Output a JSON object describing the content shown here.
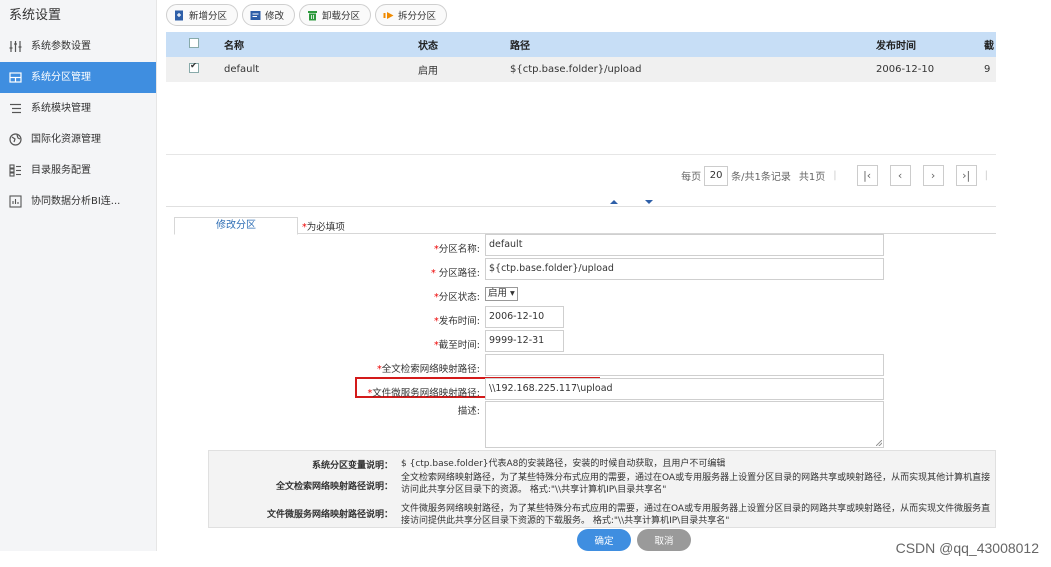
{
  "sidebar": {
    "title": "系统设置",
    "items": [
      {
        "label": "系统参数设置",
        "icon": "sliders-icon",
        "active": false
      },
      {
        "label": "系统分区管理",
        "icon": "partition-icon",
        "active": true
      },
      {
        "label": "系统模块管理",
        "icon": "list-icon",
        "active": false
      },
      {
        "label": "国际化资源管理",
        "icon": "globe-icon",
        "active": false
      },
      {
        "label": "目录服务配置",
        "icon": "directory-icon",
        "active": false
      },
      {
        "label": "协同数据分析BI连...",
        "icon": "bi-icon",
        "active": false
      }
    ]
  },
  "toolbar": {
    "add_label": "新增分区",
    "edit_label": "修改",
    "unload_label": "卸载分区",
    "split_label": "拆分分区"
  },
  "grid": {
    "columns": [
      "名称",
      "状态",
      "路径",
      "发布时间",
      "截"
    ],
    "rows": [
      {
        "checked": true,
        "name": "default",
        "status": "启用",
        "path": "${ctp.base.folder}/upload",
        "date": "2006-12-10",
        "more": "9"
      }
    ]
  },
  "pager": {
    "per_page_label": "每页",
    "page_size": "20",
    "records_text": "条/共1条记录",
    "total_pages": "共1页"
  },
  "form": {
    "tab_label": "修改分区",
    "required_note": "为必填项",
    "fields": {
      "name_label": "分区名称:",
      "name_value": "default",
      "path_label": "分区路径:",
      "path_value": "${ctp.base.folder}/upload",
      "status_label": "分区状态:",
      "status_value": "启用",
      "publish_label": "发布时间:",
      "publish_value": "2006-12-10",
      "expire_label": "截至时间:",
      "expire_value": "9999-12-31",
      "fulltext_label": "全文检索网络映射路径:",
      "fulltext_value": "",
      "fileservice_label": "文件微服务网络映射路径:",
      "fileservice_value": "\\\\192.168.225.117\\upload",
      "desc_label": "描述:"
    }
  },
  "info": {
    "var_label": "系统分区变量说明：",
    "var_text": "$ {ctp.base.folder}代表A8的安装路径，安装的时候自动获取，且用户不可编辑",
    "fulltext_label": "全文检索网络映射路径说明：",
    "fulltext_text": "全文检索网络映射路径，为了某些特殊分布式应用的需要，通过在OA或专用服务器上设置分区目录的网路共享或映射路径，从而实现其他计算机直接访问此共享分区目录下的资源。 格式:\"\\\\共享计算机IP\\目录共享名\"",
    "fileservice_label": "文件微服务网络映射路径说明：",
    "fileservice_text": "文件微服务网络映射路径，为了某些特殊分布式应用的需要，通过在OA或专用服务器上设置分区目录的网路共享或映射路径，从而实现文件微服务直接访问提供此共享分区目录下资源的下载服务。 格式:\"\\\\共享计算机IP\\目录共享名\""
  },
  "buttons": {
    "ok_label": "确定",
    "cancel_label": "取消"
  },
  "watermark": "CSDN @qq_43008012",
  "colors": {
    "accent": "#3f8ee0",
    "header_bg": "#c7def6",
    "highlight_border": "#d31a1a",
    "required": "#e00000"
  }
}
